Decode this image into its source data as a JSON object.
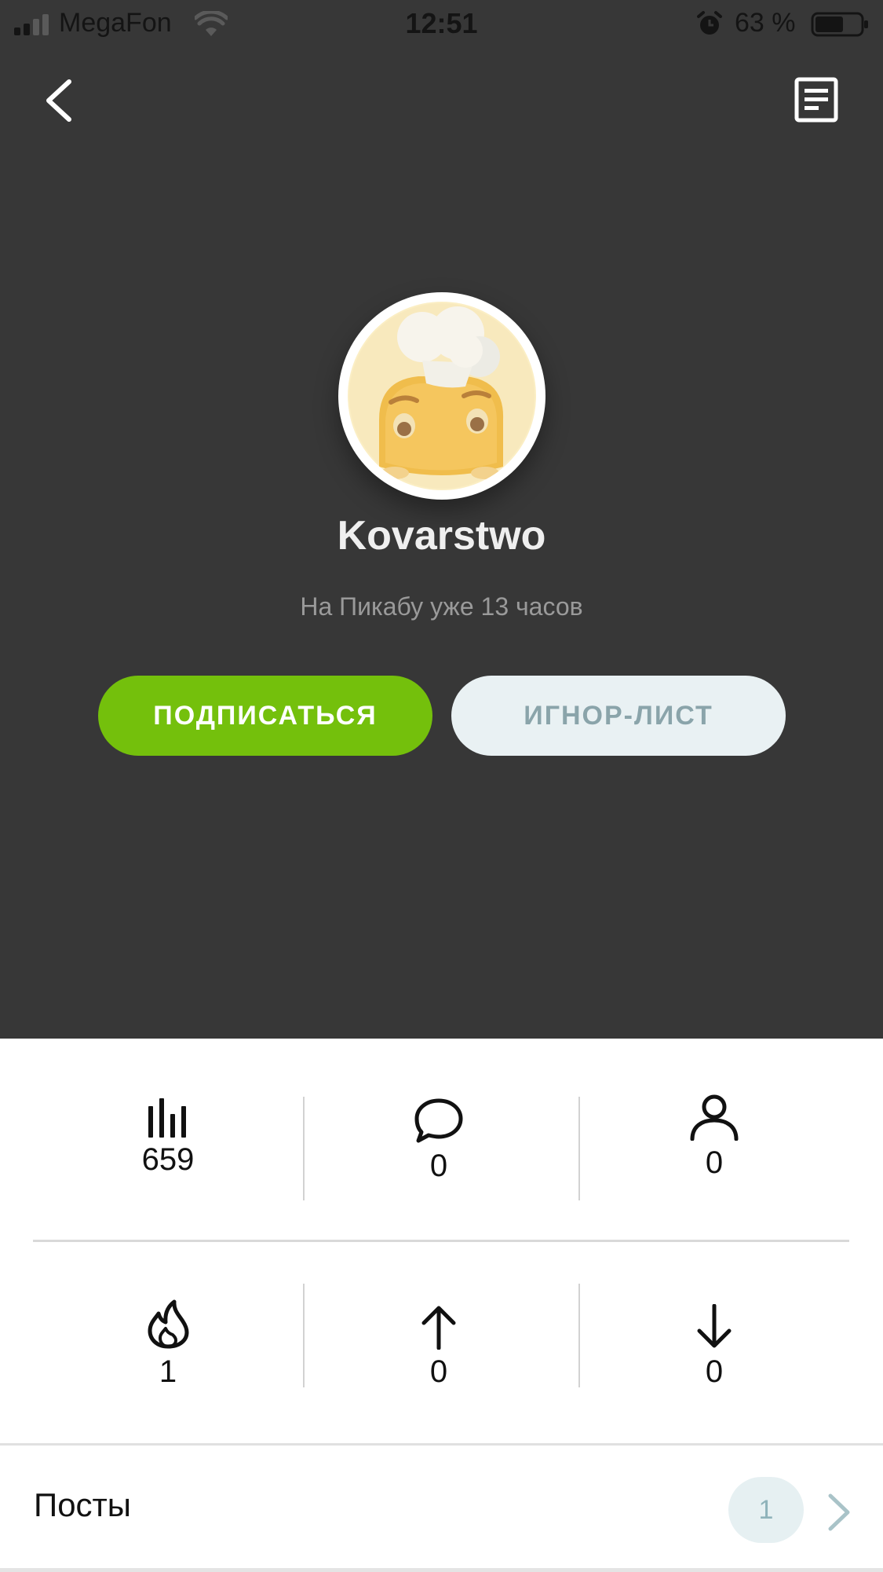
{
  "status_bar": {
    "carrier": "MegaFon",
    "time": "12:51",
    "battery_percent": "63 %",
    "battery_level": 0.63
  },
  "profile": {
    "username": "Kovarstwo",
    "since": "На Пикабу уже 13 часов",
    "subscribe_label": "ПОДПИСАТЬСЯ",
    "ignore_label": "ИГНОР-ЛИСТ"
  },
  "stats": {
    "rating": "659",
    "comments": "0",
    "subscribers": "0",
    "hot": "1",
    "pluses": "0",
    "minuses": "0"
  },
  "posts": {
    "label": "Посты",
    "count": "1"
  },
  "colors": {
    "accent_green": "#74c00c",
    "header_bg": "#373737"
  }
}
